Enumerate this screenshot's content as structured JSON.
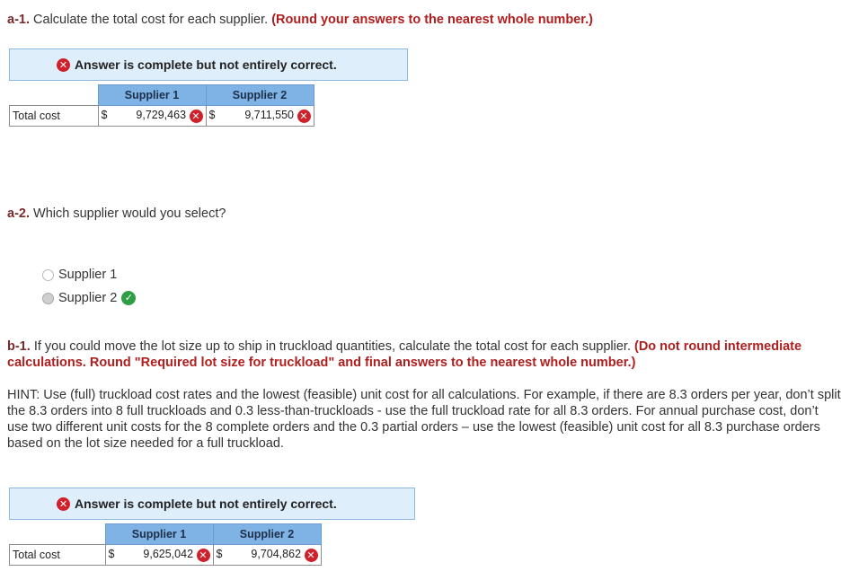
{
  "a1": {
    "num": "a-1.",
    "text": "Calculate the total cost for each supplier.",
    "instruction": "(Round your answers to the nearest whole number.)",
    "banner": "Answer is complete but not entirely correct.",
    "table": {
      "headers": [
        "Supplier 1",
        "Supplier 2"
      ],
      "row_label": "Total cost",
      "currency": "$",
      "values": [
        "9,729,463",
        "9,711,550"
      ],
      "status": [
        "incorrect",
        "incorrect"
      ]
    }
  },
  "a2": {
    "num": "a-2.",
    "text": "Which supplier would you select?",
    "options": [
      "Supplier 1",
      "Supplier 2"
    ],
    "selected": "Supplier 2",
    "selected_status": "correct"
  },
  "b1": {
    "num": "b-1.",
    "text": "If you could move the lot size up to ship in truckload quantities, calculate the total cost for each supplier.",
    "instruction": "(Do not round intermediate calculations. Round \"Required lot size for truckload\" and final answers to the nearest whole number.)",
    "hint": "HINT: Use (full) truckload cost rates and the lowest (feasible) unit cost for all calculations. For example, if there are 8.3 orders per year, don’t split the 8.3 orders into 8 full truckloads and 0.3 less-than-truckloads - use the full truckload rate for all 8.3 orders. For annual purchase cost, don’t use two different unit costs for the 8 complete orders and the 0.3 partial orders – use the lowest (feasible) unit cost for all 8.3 purchase orders based on the lot size needed for a full truckload.",
    "banner": "Answer is complete but not entirely correct.",
    "table": {
      "headers": [
        "Supplier 1",
        "Supplier 2"
      ],
      "row_label": "Total cost",
      "currency": "$",
      "values": [
        "9,625,042",
        "9,704,862"
      ],
      "status": [
        "incorrect",
        "incorrect"
      ]
    }
  },
  "icons": {
    "incorrect": "x-circle-icon",
    "correct": "check-circle-icon"
  },
  "colors": {
    "instruction_red": "#b01e1e",
    "banner_bg": "#dfeefb",
    "header_blue": "#7fb2e5",
    "incorrect_red": "#d0202a",
    "correct_green": "#2f9e44"
  }
}
